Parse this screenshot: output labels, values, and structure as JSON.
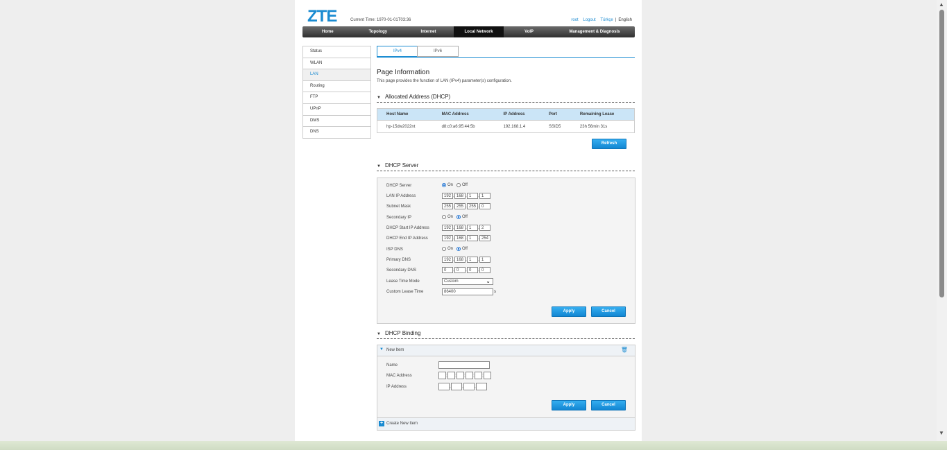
{
  "header": {
    "logo": "ZTE",
    "current_time": "Current Time: 1970-01-01T03:36",
    "links": {
      "user": "root",
      "logout": "Logout",
      "lang_tr": "Türkçe",
      "sep": "|",
      "lang_en": "English"
    }
  },
  "nav": [
    "Home",
    "Topology",
    "Internet",
    "Local Network",
    "VoIP",
    "Management & Diagnosis"
  ],
  "sidebar": [
    "Status",
    "WLAN",
    "LAN",
    "Routing",
    "FTP",
    "UPnP",
    "DMS",
    "DNS"
  ],
  "tabs": [
    "IPv4",
    "IPv6"
  ],
  "page_info": {
    "title": "Page Information",
    "desc": "This page provides the function of LAN (IPv4) parameter(s) configuration."
  },
  "allocated": {
    "title": "Allocated Address (DHCP)",
    "headers": [
      "Host Name",
      "MAC Address",
      "IP Address",
      "Port",
      "Remaining Lease"
    ],
    "rows": [
      [
        "hp-15dw2022nt",
        "d8:c0:a6:95:44:5b",
        "192.168.1.4",
        "SSID5",
        "23h 56min 31s"
      ]
    ],
    "refresh": "Refresh"
  },
  "dhcp_server": {
    "title": "DHCP Server",
    "labels": {
      "dhcp_server": "DHCP Server",
      "lan_ip": "LAN IP Address",
      "subnet": "Subnet Mask",
      "secondary_ip": "Secondary IP",
      "start_ip": "DHCP Start IP Address",
      "end_ip": "DHCP End IP Address",
      "isp_dns": "ISP DNS",
      "primary_dns": "Primary DNS",
      "secondary_dns": "Secondary DNS",
      "lease_mode": "Lease Time Mode",
      "custom_lease": "Custom Lease Time"
    },
    "on": "On",
    "off": "Off",
    "lan_ip": [
      "192",
      "168",
      "1",
      "1"
    ],
    "subnet": [
      "255",
      "255",
      "255",
      "0"
    ],
    "start_ip": [
      "192",
      "168",
      "1",
      "2"
    ],
    "end_ip": [
      "192",
      "168",
      "1",
      "254"
    ],
    "primary_dns": [
      "192",
      "168",
      "1",
      "1"
    ],
    "secondary_dns": [
      "0",
      "0",
      "0",
      "0"
    ],
    "lease_mode": "Custom",
    "custom_lease": "86400",
    "lease_unit": "s",
    "apply": "Apply",
    "cancel": "Cancel"
  },
  "dhcp_binding": {
    "title": "DHCP Binding",
    "item_title": "New Item",
    "labels": {
      "name": "Name",
      "mac": "MAC Address",
      "ip": "IP Address"
    },
    "apply": "Apply",
    "cancel": "Cancel",
    "create": "Create New Item"
  },
  "colors": {
    "accent": "#1a8bd1",
    "button": "#1a9ee6",
    "nav_bg": "#3a3a3a"
  }
}
